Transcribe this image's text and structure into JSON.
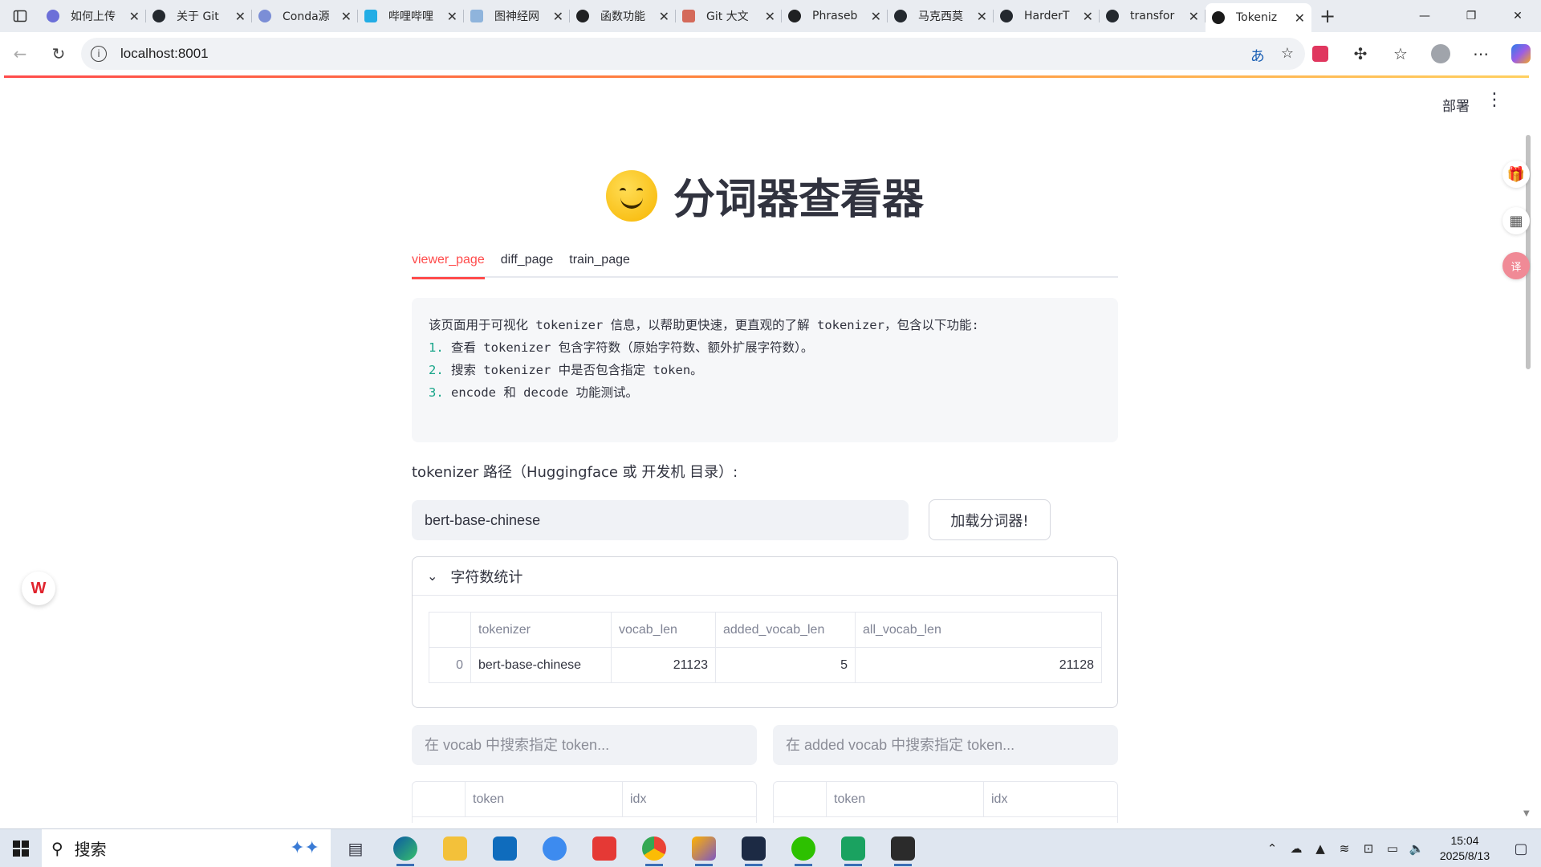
{
  "browser": {
    "tabs": [
      {
        "title": "如何上传",
        "color": "#6c6fd8"
      },
      {
        "title": "关于 Git",
        "color": "#24292f"
      },
      {
        "title": "Conda源",
        "color": "#7b8ed6"
      },
      {
        "title": "哔哩哔哩",
        "color": "#23ade5"
      },
      {
        "title": "图神经网",
        "color": "#8fb4dc"
      },
      {
        "title": "函数功能",
        "color": "#202123"
      },
      {
        "title": "Git 大文",
        "color": "#d46a5a"
      },
      {
        "title": "Phraseb",
        "color": "#202123"
      },
      {
        "title": "马克西莫",
        "color": "#24292f"
      },
      {
        "title": "HarderT",
        "color": "#24292f"
      },
      {
        "title": "transfor",
        "color": "#24292f"
      },
      {
        "title": "Tokeniz",
        "color": "#ff4b4b"
      }
    ],
    "url": "localhost:8001"
  },
  "app": {
    "deploy_label": "部署",
    "title": "分词器查看器",
    "nav_tabs": [
      "viewer_page",
      "diff_page",
      "train_page"
    ],
    "intro": {
      "line0": "该页面用于可视化 tokenizer 信息，以帮助更快速，更直观的了解 tokenizer，包含以下功能:",
      "items": [
        {
          "num": "1.",
          "text": "查看 tokenizer 包含字符数（原始字符数、额外扩展字符数）。"
        },
        {
          "num": "2.",
          "text": "搜索 tokenizer 中是否包含指定 token。"
        },
        {
          "num": "3.",
          "text": "encode 和 decode 功能测试。"
        }
      ]
    },
    "path_label": "tokenizer 路径（Huggingface 或 开发机 目录）:",
    "path_value": "bert-base-chinese",
    "load_button": "加载分词器!",
    "expander_title": "字符数统计",
    "stats_table": {
      "columns": [
        "",
        "tokenizer",
        "vocab_len",
        "added_vocab_len",
        "all_vocab_len"
      ],
      "rows": [
        {
          "index": "0",
          "tokenizer": "bert-base-chinese",
          "vocab_len": "21123",
          "added_vocab_len": "5",
          "all_vocab_len": "21128"
        }
      ]
    },
    "vocab_search_placeholder": "在 vocab 中搜索指定 token...",
    "added_search_placeholder": "在 added vocab 中搜索指定 token...",
    "token_table_columns": [
      "",
      "token",
      "idx"
    ]
  },
  "taskbar": {
    "search_label": "搜索",
    "time": "15:04",
    "date": "2025/8/13"
  }
}
